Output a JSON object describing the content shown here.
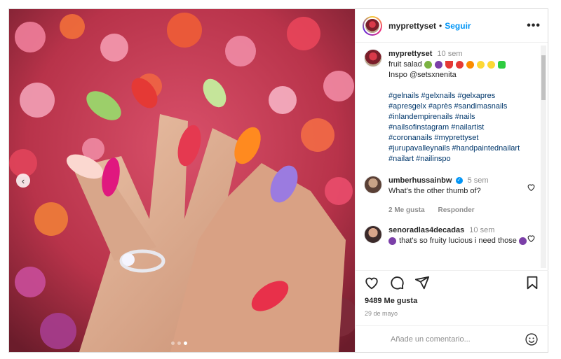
{
  "post": {
    "username": "myprettyset",
    "follow_label": "Seguir",
    "more_label": "•••",
    "separator": "•"
  },
  "caption": {
    "username": "myprettyset",
    "time": "10 sem",
    "text": "fruit salad",
    "emojis": [
      "kiwi-emoji",
      "grapes-emoji",
      "watermelon-emoji",
      "strawberry-emoji",
      "orange-emoji",
      "lemon-emoji",
      "lemon-emoji",
      "green-square-emoji"
    ],
    "inspo": "Inspo @setsxnenita",
    "hashtags": "#gelnails #gelxnails #gelxapres #apresgelx #après #sandimasnails #inlandempirenails #nails #nailsofinstagram #nailartist #coronanails #myprettyset #jurupavalleynails #handpaintednailart #nailart #nailinspo"
  },
  "comments": [
    {
      "username": "umberhussainbw",
      "verified": true,
      "time": "5 sem",
      "text": "What's the other thumb of?",
      "likes_label": "2 Me gusta",
      "reply_label": "Responder"
    },
    {
      "username": "senoradlas4decadas",
      "time": "10 sem",
      "text": "that's so fruity lucious i need those"
    }
  ],
  "likes": "9489 Me gusta",
  "date": "29 de mayo",
  "comment_placeholder": "Añade un comentario...",
  "colors": {
    "accent": "#0095f6",
    "text": "#262626",
    "muted": "#8e8e8e",
    "link": "#00376b"
  }
}
